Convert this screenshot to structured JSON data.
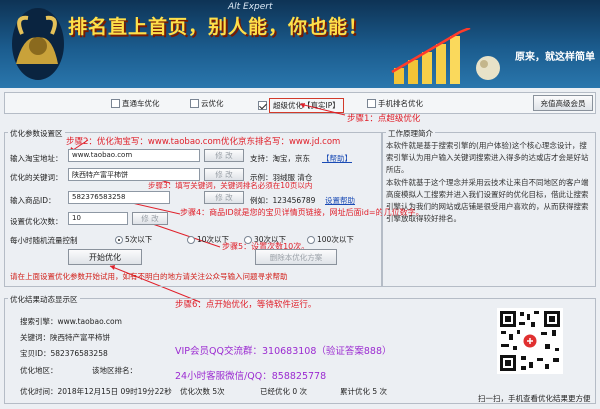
{
  "banner": {
    "app_name": "Alt Expert",
    "tagline": "排名直上首页，别人能，你也能！",
    "subtag": "原来，就这样简单"
  },
  "options": {
    "items": [
      {
        "label": "直通车优化",
        "checked": false
      },
      {
        "label": "云优化",
        "checked": false
      },
      {
        "label": "超级优化【真实IP】",
        "checked": true
      },
      {
        "label": "手机排名优化",
        "checked": false
      }
    ],
    "advanced_button": "充值高级会员"
  },
  "steps": {
    "s1": "步骤1：点超级优化",
    "s2": "步骤2：优化淘宝写：www.taobao.com优化京东排名写：www.jd.com",
    "s3": "步骤3：填写关键词，关键词排名必须在10页以内",
    "s4": "步骤4：商品ID就是您的宝贝详情页链接，网址后面id=的几位数字。",
    "s5": "步骤5：设置次数10次。",
    "s6": "步骤6：点开始优化，等待软件运行。"
  },
  "params": {
    "title": "优化参数设置区",
    "shop_label": "输入淘宝地址：",
    "shop_value": "www.taobao.com",
    "modify": "修 改",
    "shop_support": "支持：淘宝，京东",
    "help": "【帮助】",
    "kw_label": "优化的关键词：",
    "kw_value": "陕西特产富平柿饼",
    "kw_example": "示例：羽绒服 清仓",
    "id_label": "输入商品ID：",
    "id_value": "582376583258",
    "id_example": "例如：123456789",
    "id_help": "设置帮助",
    "times_label": "设置优化次数：",
    "times_value": "10",
    "hour_label": "每小时随机流量控制",
    "radios": [
      {
        "label": "5次以下",
        "on": true
      },
      {
        "label": "10次以下",
        "on": false
      },
      {
        "label": "30次以下",
        "on": false
      },
      {
        "label": "100次以下",
        "on": false
      }
    ],
    "start": "开始优化",
    "delete_plan": "删除本优化方案",
    "warning": "请在上面设置优化参数开始试用，如有不明白的地方请关注公众号输入问题寻求帮助"
  },
  "intro": {
    "title": "工作原理简介",
    "p1": "本软件就是基于搜索引擎的(用户体验)这个核心理念设计，搜索引擎认为用户输入关键词搜索进入得多的达或店才会是好站所店。",
    "p2": "本软件就基于这个理念并采用云技术让来自不同地区的客户端高度模拟人工搜索并进入我们设置好的优化目标，借此让搜索引擎认为我们的网站或店铺是很受用户喜欢的，从而获得搜索引擎放取得较好排名。"
  },
  "results": {
    "title": "优化结果动态显示区",
    "engine": "搜索引擎：www.taobao.com",
    "keyword": "关键词：陕西特产富平柿饼",
    "item_id": "宝贝ID：582376583258",
    "region_label": "优化地区：",
    "rank_label": "该地区排名：",
    "date": "优化时间：2018年12月15日 09时19分22秒",
    "count": "优化次数 5次",
    "done": "已经优化 0 次",
    "total": "累计优化 5 次",
    "qq": "VIP会员QQ交流群：310683108（验证答案888）",
    "wechat": "24小时客服微信/QQ：858825778",
    "scan": "扫一扫，手机查看优化结果更方便"
  }
}
